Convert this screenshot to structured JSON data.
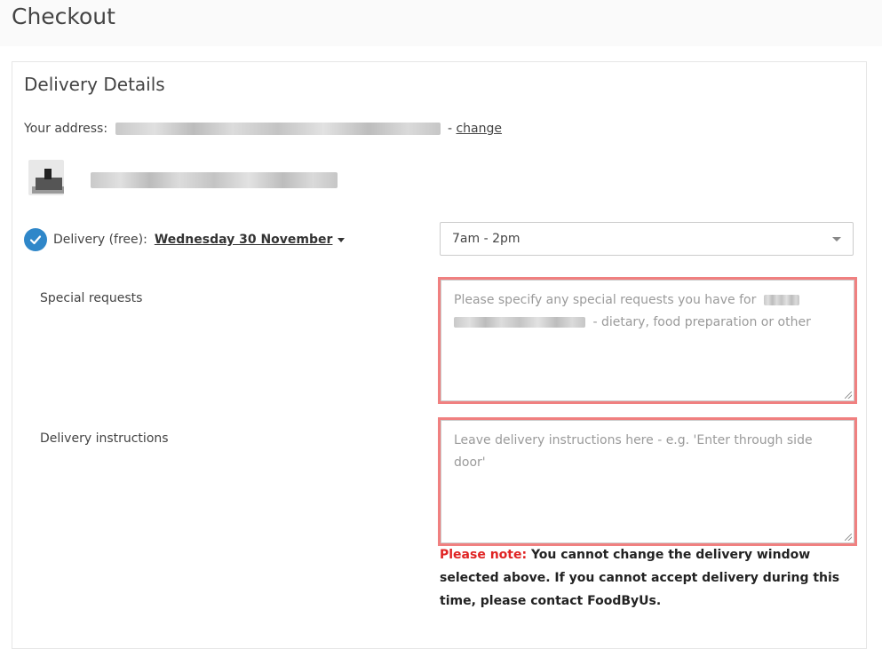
{
  "page": {
    "title": "Checkout"
  },
  "delivery_details": {
    "heading": "Delivery Details",
    "address_label": "Your address:",
    "address_separator": "-",
    "change_link": "change",
    "delivery_label": "Delivery (free):",
    "delivery_date": "Wednesday 30 November",
    "time_window": {
      "selected": "7am - 2pm"
    },
    "special_requests": {
      "label": "Special requests",
      "placeholder_start": "Please specify any special requests you have for",
      "placeholder_end": "- dietary, food preparation or other"
    },
    "delivery_instructions": {
      "label": "Delivery instructions",
      "placeholder": "Leave delivery instructions here - e.g. 'Enter through side door'"
    },
    "note": {
      "label": "Please note:",
      "text": "You cannot change the delivery window selected above. If you cannot accept delivery during this time, please contact FoodByUs."
    }
  },
  "colors": {
    "accent_check": "#2f87c9",
    "highlight_border": "#f08080",
    "note_label": "#e02424"
  },
  "icons": {
    "check": "check-circle-icon",
    "date_caret": "caret-down-icon",
    "select_arrow": "chevron-down-icon",
    "resize": "resize-handle-icon"
  }
}
